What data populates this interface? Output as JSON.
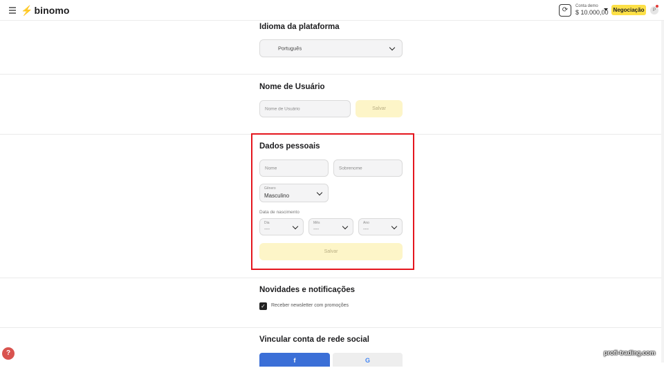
{
  "header": {
    "logo_text": "binomo",
    "account_label": "Conta demo",
    "balance": "$ 10.000,00",
    "trade_button": "Negociação",
    "avatar_initial": "P"
  },
  "language": {
    "title": "Idioma da plataforma",
    "selected": "Português"
  },
  "username": {
    "title": "Nome de Usuário",
    "placeholder": "Nome de Usuário",
    "save_label": "Salvar"
  },
  "personal": {
    "title": "Dados pessoais",
    "first_name_placeholder": "Nome",
    "last_name_placeholder": "Sobrenome",
    "gender_label": "Gênero",
    "gender_value": "Masculino",
    "dob_label": "Data de nascimento",
    "day_label": "Dia",
    "day_value": "---",
    "month_label": "Mês",
    "month_value": "---",
    "year_label": "Ano",
    "year_value": "---",
    "save_label": "Salvar"
  },
  "notifications": {
    "title": "Novidades e notificações",
    "newsletter_label": "Receber newsletter com promoções",
    "newsletter_checked": true
  },
  "social": {
    "title": "Vincular conta de rede social",
    "facebook_label": "f",
    "google_label": "G"
  },
  "watermark": "profi-trading.com",
  "colors": {
    "accent": "#fde047",
    "highlight": "#e4151d",
    "facebook": "#3b6fd7"
  }
}
